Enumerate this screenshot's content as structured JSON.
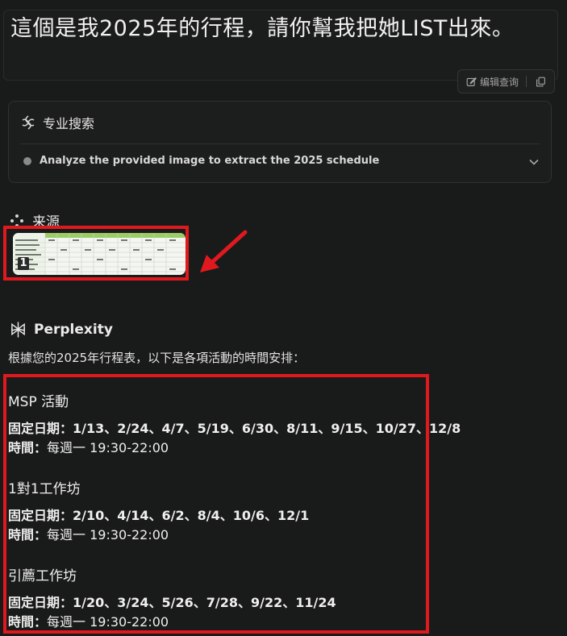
{
  "query": {
    "text": "這個是我2025年的行程，請你幫我把她LIST出來。",
    "edit_label": "编辑查询"
  },
  "pro_search": {
    "title": "专业搜索",
    "step": "Analyze the provided image to extract the 2025 schedule"
  },
  "sources": {
    "title": "来源",
    "badge": "1"
  },
  "answer": {
    "brand": "Perplexity",
    "intro": "根據您的2025年行程表，以下是各項活動的時間安排：",
    "sections": [
      {
        "title": "MSP 活動",
        "dates_label": "固定日期：",
        "dates": "1/13、2/24、4/7、5/19、6/30、8/11、9/15、10/27、12/8",
        "time_label": "時間：",
        "time": "每週一 19:30-22:00"
      },
      {
        "title": "1對1工作坊",
        "dates_label": "固定日期：",
        "dates": "2/10、4/14、6/2、8/4、10/6、12/1",
        "time_label": "時間：",
        "time": "每週一 19:30-22:00"
      },
      {
        "title": "引薦工作坊",
        "dates_label": "固定日期：",
        "dates": "1/20、3/24、5/26、7/28、9/22、11/24",
        "time_label": "時間：",
        "time": "每週一 19:30-22:00"
      }
    ]
  },
  "colors": {
    "background": "#191a1a",
    "highlight_red": "#e0191f",
    "text": "#e8e8e6"
  }
}
